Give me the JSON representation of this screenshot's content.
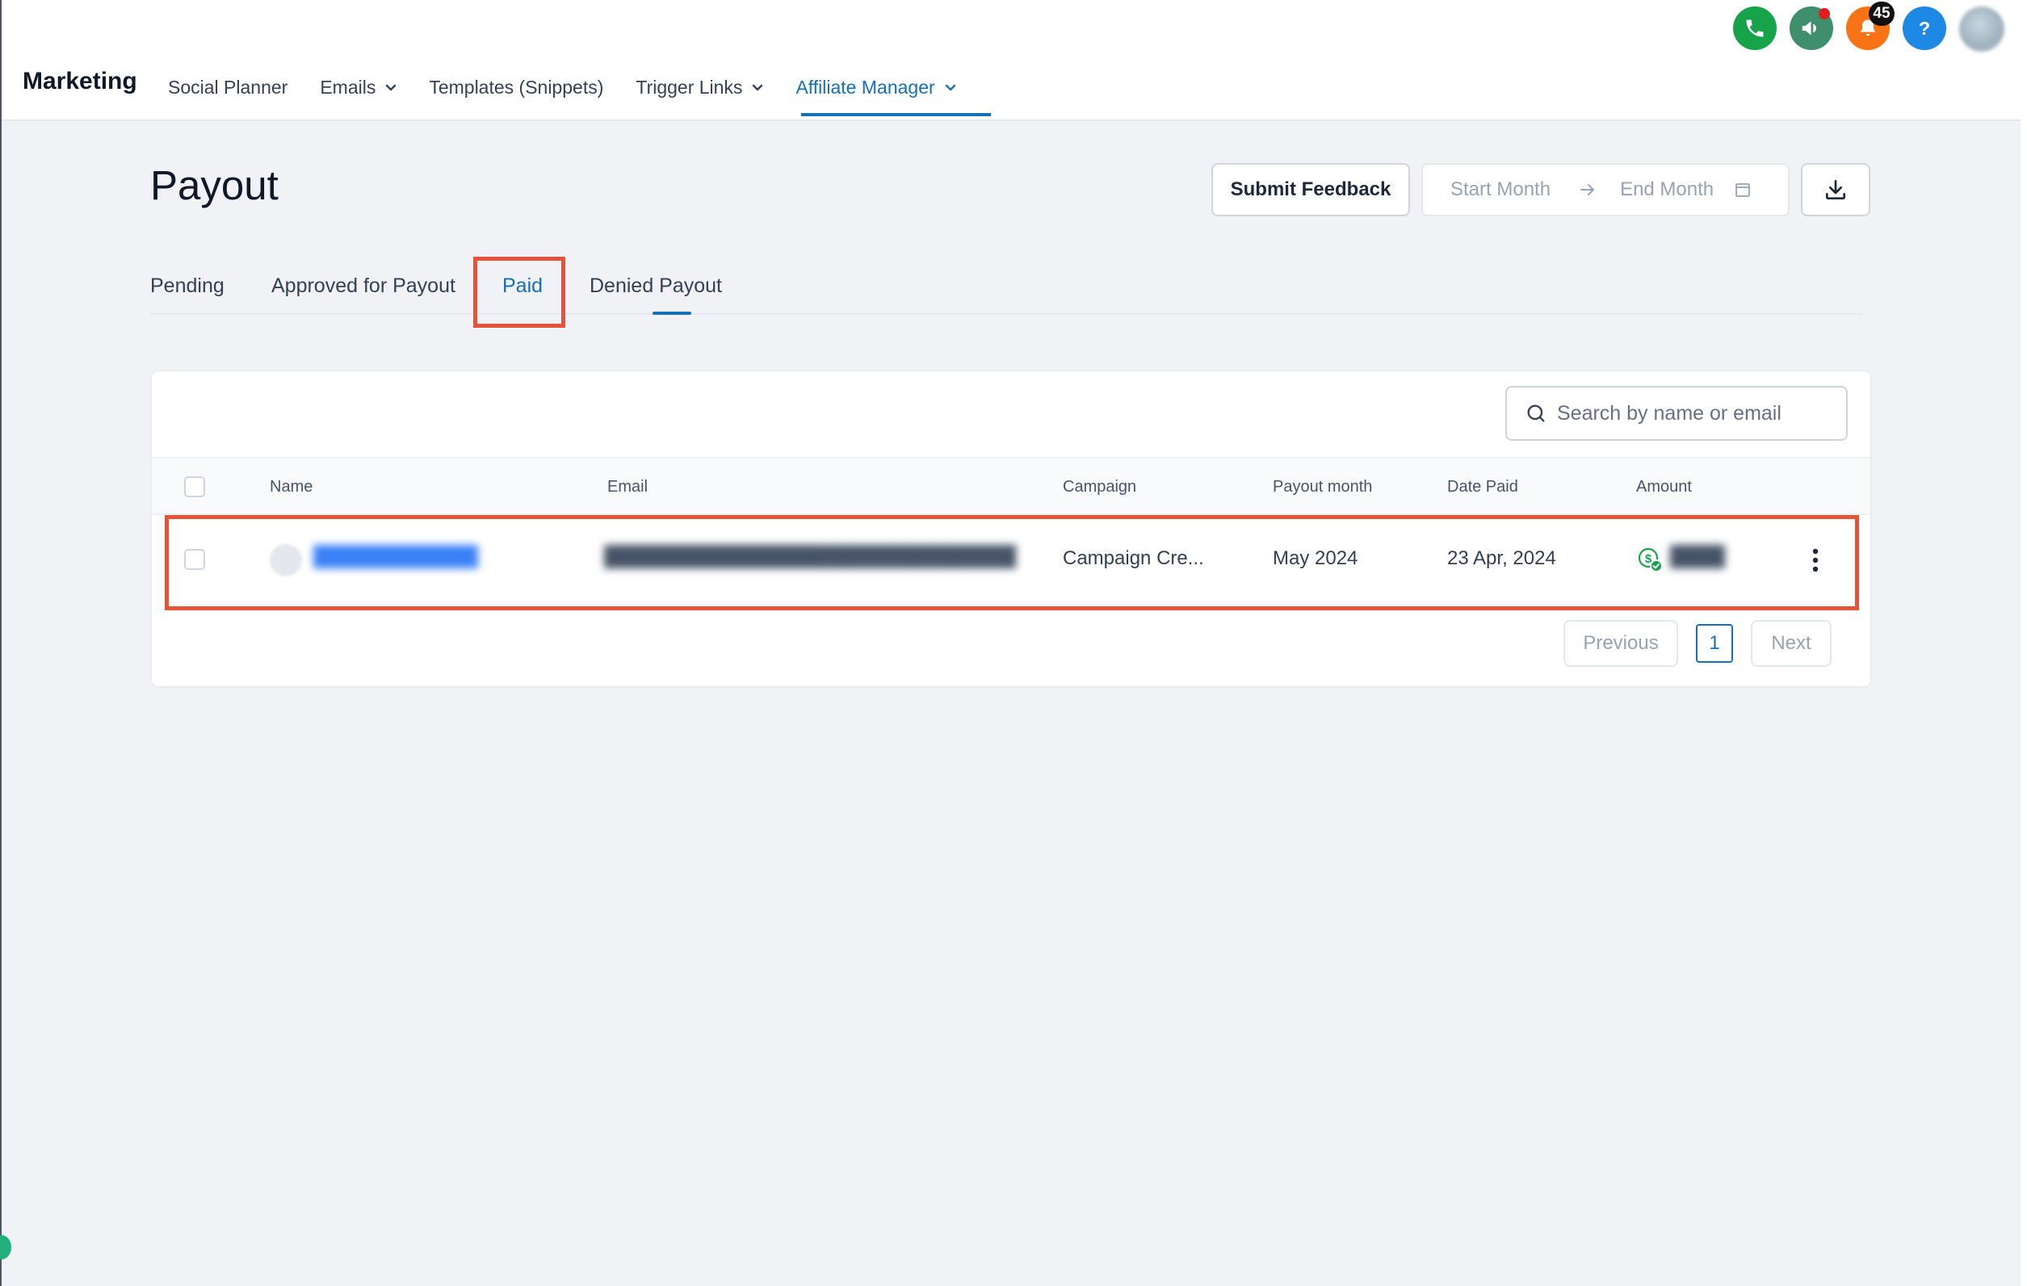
{
  "header": {
    "brand": "Marketing",
    "nav": [
      {
        "label": "Social Planner"
      },
      {
        "label": "Emails"
      },
      {
        "label": "Templates (Snippets)"
      },
      {
        "label": "Trigger Links"
      },
      {
        "label": "Affiliate Manager"
      }
    ],
    "active_nav": "Affiliate Manager",
    "notification_count": "45",
    "icons": [
      "phone-icon",
      "megaphone-icon",
      "bell-icon",
      "help-icon",
      "avatar"
    ]
  },
  "page": {
    "title": "Payout",
    "submit_feedback": "Submit Feedback",
    "start_month_placeholder": "Start Month",
    "end_month_placeholder": "End Month"
  },
  "tabs": [
    {
      "label": "Pending"
    },
    {
      "label": "Approved for Payout"
    },
    {
      "label": "Paid"
    },
    {
      "label": "Denied Payout"
    }
  ],
  "active_tab": "Paid",
  "search": {
    "placeholder": "Search by name or email"
  },
  "table": {
    "columns": [
      "Name",
      "Email",
      "Campaign",
      "Payout month",
      "Date Paid",
      "Amount"
    ],
    "rows": [
      {
        "name": "████████████",
        "email": "██████████████████████████████",
        "campaign": "Campaign Cre...",
        "payout_month": "May 2024",
        "date_paid": "23 Apr, 2024",
        "amount": "████"
      }
    ]
  },
  "pagination": {
    "previous": "Previous",
    "page": "1",
    "next": "Next"
  },
  "colors": {
    "accent": "#1570b8",
    "highlight": "#e4533a",
    "success": "#16a34a"
  }
}
